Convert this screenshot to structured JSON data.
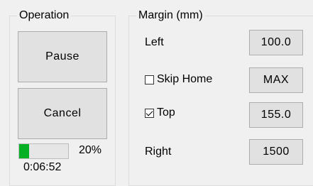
{
  "operation": {
    "group_title": "Operation",
    "pause_label": "Pause",
    "cancel_label": "Cancel",
    "progress_percent_text": "20%",
    "progress_value": 0.2,
    "elapsed_time": "0:06:52"
  },
  "margin": {
    "group_title": "Margin (mm)",
    "left_label": "Left",
    "left_value": "100.0",
    "skip_home_label": "Skip Home",
    "skip_home_checked": false,
    "skip_home_value": "MAX",
    "top_label": "Top",
    "top_checked": true,
    "top_value": "155.0",
    "right_label": "Right",
    "right_value": "1500"
  },
  "colors": {
    "background": "#f0f0f0",
    "button_face": "#e1e1e1",
    "progress_green": "#06b025"
  }
}
